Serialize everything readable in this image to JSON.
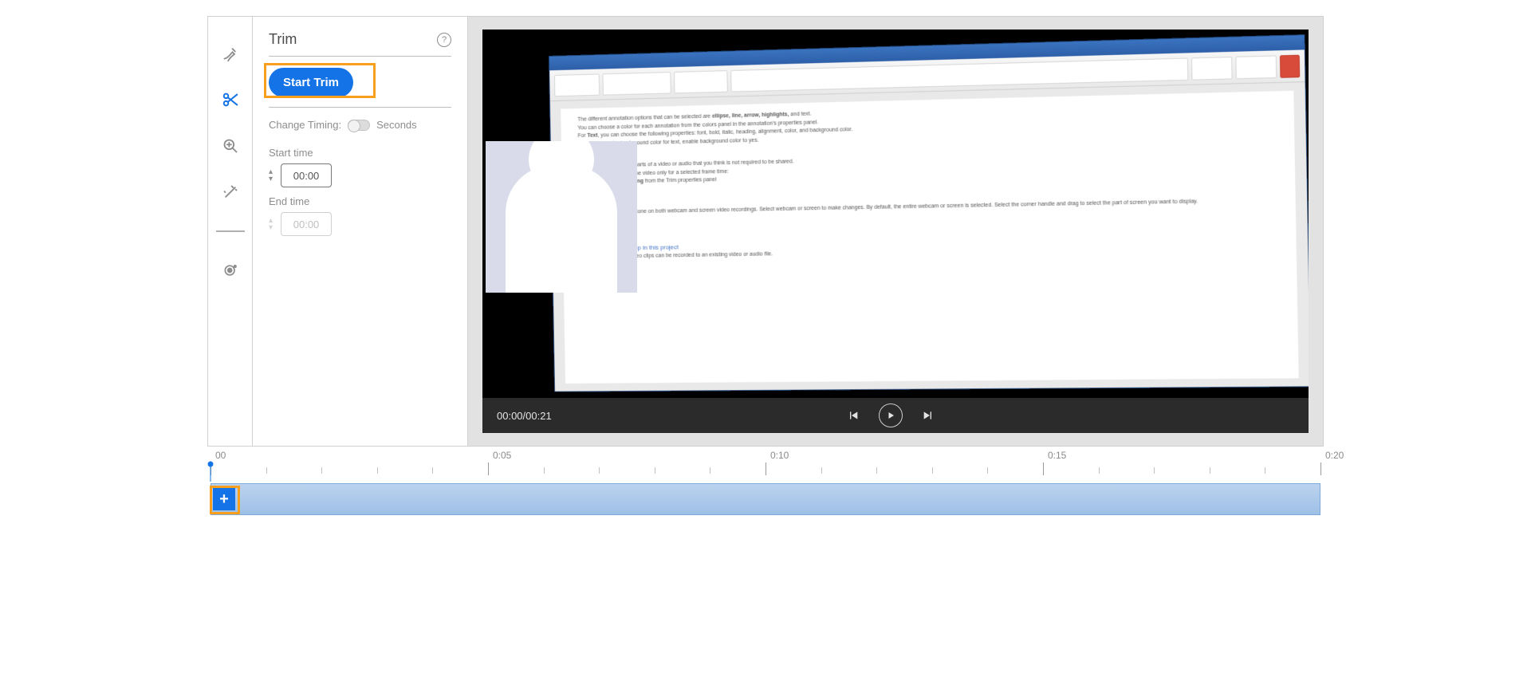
{
  "toolbar": {
    "tools": [
      {
        "name": "annotate-tool",
        "active": false
      },
      {
        "name": "trim-tool",
        "active": true
      },
      {
        "name": "zoom-tool",
        "active": false
      },
      {
        "name": "enhance-tool",
        "active": false
      }
    ],
    "record_tool": {
      "name": "record-tool"
    }
  },
  "panel": {
    "title": "Trim",
    "start_button": "Start Trim",
    "change_timing_label": "Change Timing:",
    "seconds_label": "Seconds",
    "start_time_label": "Start time",
    "start_time_value": "00:00",
    "end_time_label": "End time",
    "end_time_value": "00:00"
  },
  "preview": {
    "current_time": "00:00",
    "total_time": "00:21",
    "time_display": "00:00/00:21"
  },
  "timeline": {
    "marks": [
      "00",
      "0:05",
      "0:10",
      "0:15",
      "0:20"
    ]
  }
}
